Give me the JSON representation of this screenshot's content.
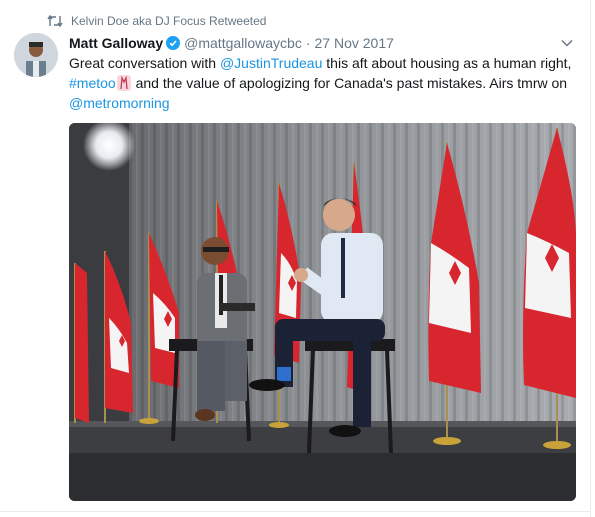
{
  "retweet": {
    "icon": "retweet-icon",
    "text": "Kelvin Doe aka DJ Focus Retweeted"
  },
  "tweet": {
    "display_name": "Matt Galloway",
    "verified_icon": "verified-badge-icon",
    "handle": "@mattgallowaycbc",
    "separator": "·",
    "timestamp": "27 Nov 2017",
    "text": {
      "part1": "Great conversation with ",
      "mention1": "@JustinTrudeau",
      "part2": " this aft about housing as a human right,",
      "hashtag": "#metoo",
      "part3": " and the value of apologizing for Canada's past mistakes. Airs tmrw on",
      "mention2": "@metromorning"
    },
    "menu_icon": "chevron-down-icon",
    "media": {
      "type": "photo",
      "subject": "two men seated on a stage in front of Canadian flags"
    }
  },
  "colors": {
    "text": "#14171a",
    "secondary": "#657786",
    "link": "#1b95e0",
    "verified": "#1da1f2"
  }
}
